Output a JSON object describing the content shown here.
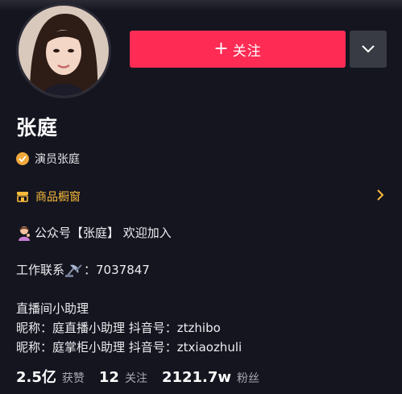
{
  "profile": {
    "name": "张庭",
    "verification": "演员张庭"
  },
  "actions": {
    "follow_plus": "+",
    "follow_label": "关注"
  },
  "shop": {
    "label": "商品橱窗"
  },
  "bio": {
    "line1": "公众号【张庭】 欢迎加入",
    "line2": "工作联系",
    "line2_value": "：7037847",
    "line3": "直播间小助理",
    "line4": "昵称：庭直播小助理  抖音号：ztzhibo",
    "line5": "昵称：庭掌柜小助理  抖音号：ztxiaozhuli"
  },
  "stats": [
    {
      "value": "2.5亿",
      "label": "获赞"
    },
    {
      "value": "12",
      "label": "关注"
    },
    {
      "value": "2121.7w",
      "label": "粉丝"
    }
  ],
  "colors": {
    "background": "#14151f",
    "follow": "#fe2c55",
    "accent": "#fabb3c",
    "badge": "#f2a93b"
  },
  "icons": [
    "avatar-photo",
    "chevron-down-icon",
    "verified-badge-icon",
    "shop-icon",
    "chevron-right-icon",
    "woman-emoji-icon",
    "satellite-emoji-icon"
  ]
}
